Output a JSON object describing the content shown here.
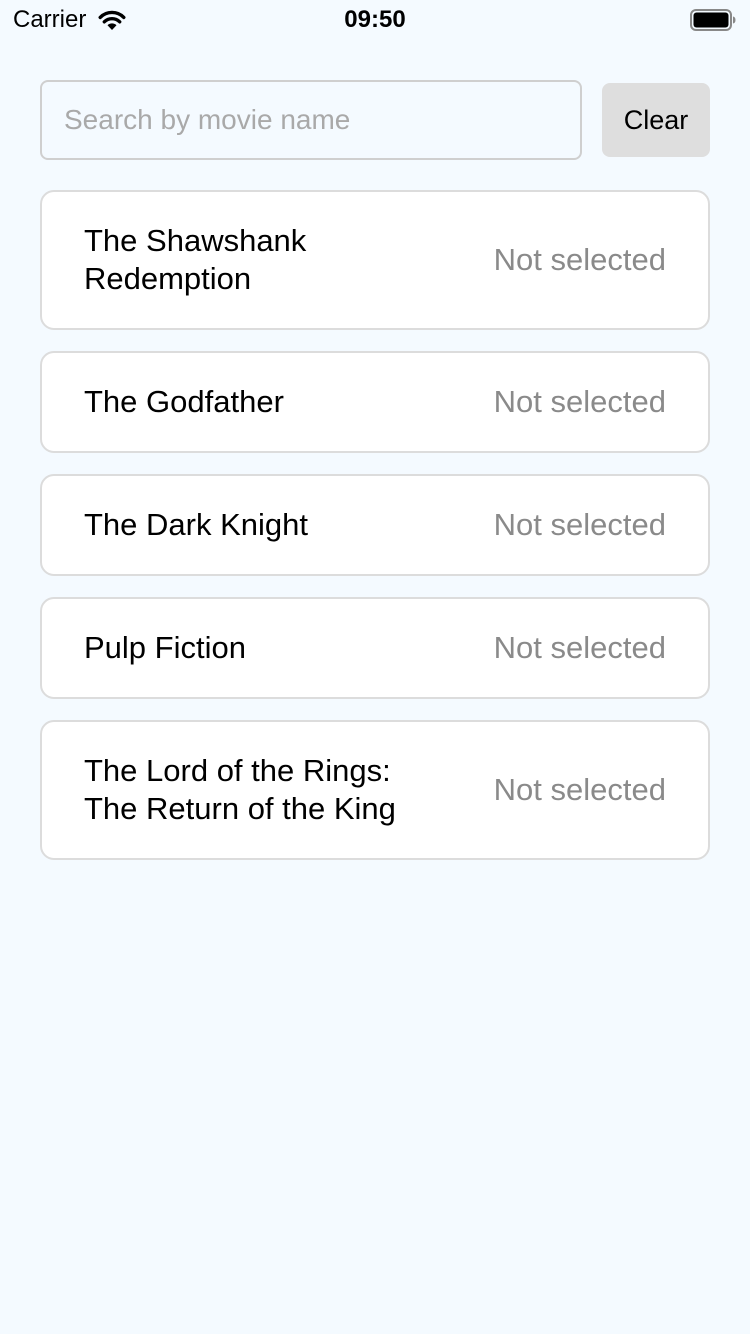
{
  "status_bar": {
    "carrier": "Carrier",
    "time": "09:50",
    "icons": [
      "wifi-icon",
      "battery-icon"
    ]
  },
  "search": {
    "value": "",
    "placeholder": "Search by movie name",
    "clear_label": "Clear"
  },
  "movies": [
    {
      "title": "The Shawshank Redemption",
      "status": "Not selected"
    },
    {
      "title": "The Godfather",
      "status": "Not selected"
    },
    {
      "title": "The Dark Knight",
      "status": "Not selected"
    },
    {
      "title": "Pulp Fiction",
      "status": "Not selected"
    },
    {
      "title": "The Lord of the Rings: The Return of the King",
      "status": "Not selected"
    }
  ],
  "colors": {
    "background": "#f4faff",
    "card": "#ffffff",
    "border": "#dcdcdc",
    "button": "#dedede",
    "muted_text": "#8a8a8a"
  }
}
